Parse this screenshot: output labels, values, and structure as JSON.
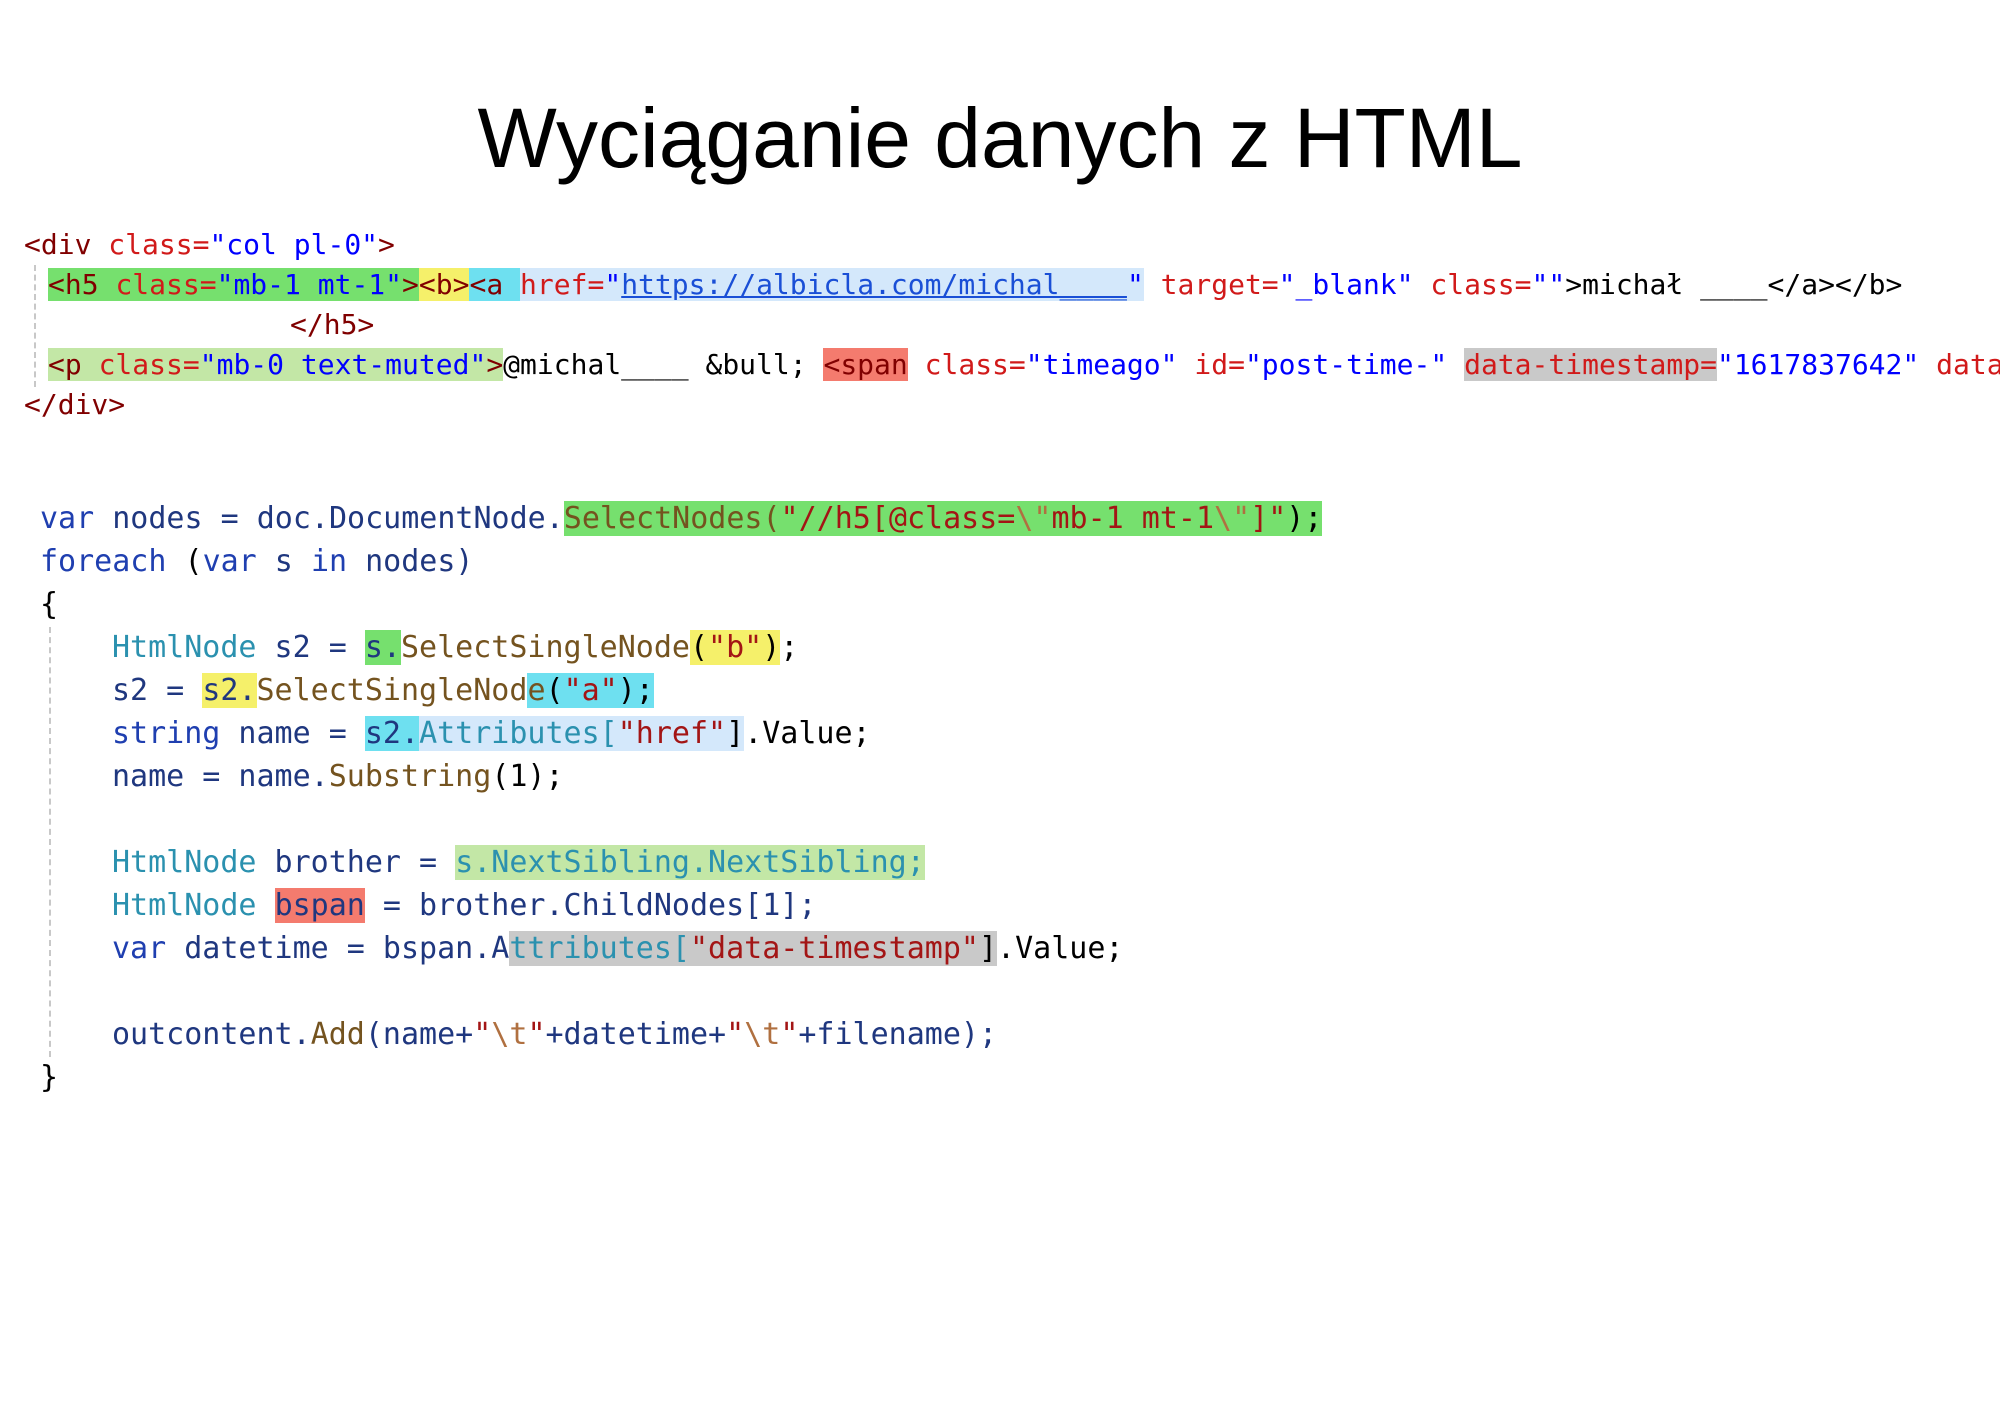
{
  "slide": {
    "title": "Wyciąganie danych z HTML"
  },
  "html_snippet": {
    "l1": {
      "a": "<div ",
      "b": "class=",
      "c": "\"col pl-0\"",
      "d": ">"
    },
    "l2": {
      "a": "<h5 ",
      "b": "class=",
      "c": "\"mb-1 mt-1\"",
      "d": ">",
      "e": "<b>",
      "f": "<a ",
      "g": "href=",
      "h": "\"",
      "i": "https://albicla.com/michal____",
      "j": "\"",
      "k": " target=",
      "l": "\"_blank\"",
      "m": " class=",
      "n": "\"\"",
      "o": ">michał ____</a></b>"
    },
    "l3": {
      "a": "</h5>"
    },
    "l4": {
      "a": "<p ",
      "b": "class=",
      "c": "\"mb-0 text-muted\"",
      "d": ">",
      "e": "@michal____ &bull; ",
      "f": "<span",
      "g": " class=",
      "h": "\"timeago\"",
      "i": " id=",
      "j": "\"post-time-\"",
      "k": " ",
      "l": "data-timestamp=",
      "m": "\"1617837642\"",
      "n": " data-t"
    },
    "l5": {
      "a": "</div>"
    }
  },
  "csharp": {
    "l1": {
      "a": "var",
      "b": " nodes = doc.DocumentNode.",
      "c": "SelectNodes(",
      "d": "\"//h5[@class=",
      "e": "\\\"",
      "f": "mb-1 mt-1",
      "g": "\\\"",
      "h": "]\"",
      "i": ");"
    },
    "l2": {
      "a": "foreach",
      "b": " (",
      "c": "var",
      "d": " s ",
      "e": "in",
      "f": " nodes)"
    },
    "l3": {
      "a": "{"
    },
    "l4": {
      "a": "HtmlNode",
      "b": " s2 = ",
      "c": "s.",
      "d": "SelectSingleNode",
      "e": "(",
      "f": "\"b\"",
      "g": ")",
      "h": ";"
    },
    "l5": {
      "a": "s2 = ",
      "b": "s2.",
      "c": "SelectSingleNod",
      "d": "e",
      "e": "(",
      "f": "\"a\"",
      "g": ");"
    },
    "l6": {
      "a": "string",
      "b": " name = ",
      "c": "s2.",
      "d": "Attributes[",
      "e": "\"href\"",
      "f": "]",
      "g": ".Value;"
    },
    "l7": {
      "a": "name = name.",
      "b": "Substring",
      "c": "(1);"
    },
    "l8": {
      "a": "HtmlNode",
      "b": " brother = ",
      "c": "s.NextSibling.NextSibling;"
    },
    "l9": {
      "a": "HtmlNode",
      "b": " ",
      "c": "bspan",
      "d": " = brother.ChildNodes[1];"
    },
    "l10": {
      "a": "var",
      "b": " datetime = bspan.A",
      "c": "ttributes[",
      "d": "\"data-timestamp\"",
      "e": "]",
      "f": ".Value;"
    },
    "l11": {
      "a": "outcontent.",
      "b": "Add",
      "c": "(name+",
      "d": "\"",
      "e": "\\t",
      "f": "\"",
      "g": "+datetime+",
      "h": "\"",
      "i": "\\t",
      "j": "\"",
      "k": "+filename);"
    },
    "l12": {
      "a": "}"
    }
  },
  "colors": {
    "highlight_green": "#76e06e",
    "highlight_yellow": "#f5f06a",
    "highlight_cyan": "#6ee0f0",
    "highlight_light_blue": "#d4e8fb",
    "highlight_light_green": "#c3e7a6",
    "highlight_red": "#f47b6e",
    "highlight_gray": "#c9c9c9"
  }
}
